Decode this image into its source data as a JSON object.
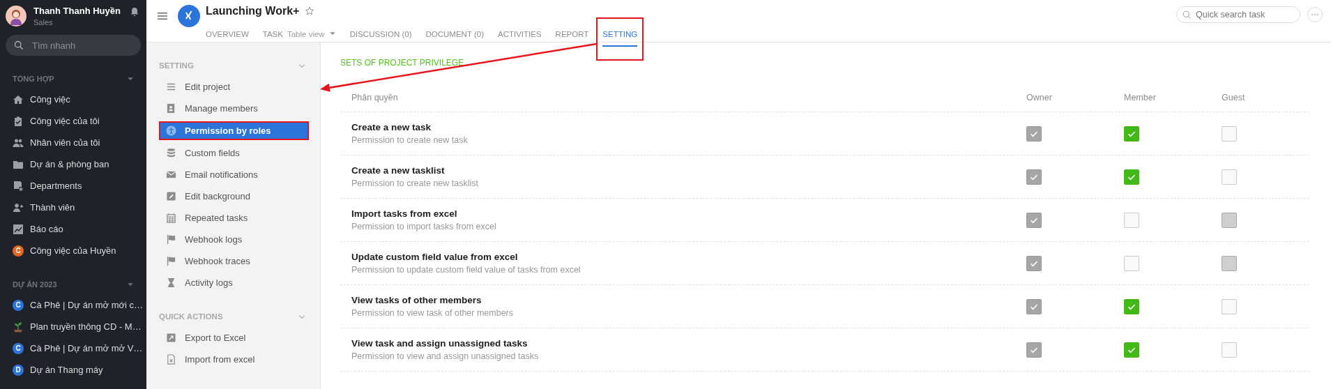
{
  "sidebar": {
    "user": {
      "name": "Thanh Thanh Huyền",
      "role": "Sales"
    },
    "search": {
      "placeholder": "Tìm nhanh"
    },
    "sections": [
      {
        "title": "TỔNG HỢP",
        "items": [
          {
            "label": "Công việc"
          },
          {
            "label": "Công việc của tôi"
          },
          {
            "label": "Nhân viên của tôi"
          },
          {
            "label": "Dự án & phòng ban"
          },
          {
            "label": "Departments"
          },
          {
            "label": "Thành viên"
          },
          {
            "label": "Báo cáo"
          },
          {
            "label": "Công việc của Huyền",
            "badge": "C",
            "color": "#e8671f"
          }
        ]
      },
      {
        "title": "DỰ ÁN 2023",
        "items": [
          {
            "label": "Cà Phê | Dự án mở mới c…",
            "badge": "C",
            "color": "#2d74da"
          },
          {
            "label": "Plan truyền thông CD - M…"
          },
          {
            "label": "Cà Phê | Dự án mở mở V…",
            "badge": "C",
            "color": "#2d74da"
          },
          {
            "label": "Dự án Thang máy",
            "badge": "D",
            "color": "#2d74da"
          }
        ]
      }
    ]
  },
  "header": {
    "title": "Launching Work+",
    "tabs": [
      {
        "label": "OVERVIEW",
        "selected": false,
        "highlighted": false
      },
      {
        "label": "TASK",
        "view": "Table view",
        "selected": false,
        "highlighted": false
      },
      {
        "label": "DISCUSSION (0)",
        "selected": false,
        "highlighted": false
      },
      {
        "label": "DOCUMENT (0)",
        "selected": false,
        "highlighted": false
      },
      {
        "label": "ACTIVITIES",
        "selected": false,
        "highlighted": false
      },
      {
        "label": "REPORT",
        "selected": false,
        "highlighted": false
      },
      {
        "label": "SETTING",
        "selected": true,
        "highlighted": true
      }
    ],
    "search": {
      "placeholder": "Quick search task"
    }
  },
  "settings_menu": {
    "sections": [
      {
        "title": "SETTING",
        "items": [
          {
            "label": "Edit project",
            "selected": false,
            "highlighted": false
          },
          {
            "label": "Manage members",
            "selected": false,
            "highlighted": false
          },
          {
            "label": "Permission by roles",
            "selected": true,
            "highlighted": true
          },
          {
            "label": "Custom fields",
            "selected": false,
            "highlighted": false
          },
          {
            "label": "Email notifications",
            "selected": false,
            "highlighted": false
          },
          {
            "label": "Edit background",
            "selected": false,
            "highlighted": false
          },
          {
            "label": "Repeated tasks",
            "selected": false,
            "highlighted": false
          },
          {
            "label": "Webhook logs",
            "selected": false,
            "highlighted": false
          },
          {
            "label": "Webhook traces",
            "selected": false,
            "highlighted": false
          },
          {
            "label": "Activity logs",
            "selected": false,
            "highlighted": false
          }
        ]
      },
      {
        "title": "QUICK ACTIONS",
        "items": [
          {
            "label": "Export to Excel",
            "selected": false,
            "highlighted": false
          },
          {
            "label": "Import from excel",
            "selected": false,
            "highlighted": false
          }
        ]
      }
    ]
  },
  "privileges": {
    "title": "SETS OF PROJECT PRIVILEGE",
    "columns": [
      "Phân quyền",
      "Owner",
      "Member",
      "Guest"
    ],
    "rows": [
      {
        "title": "Create a new task",
        "description": "Permission to create new task",
        "owner": {
          "checked": true,
          "disabled": true
        },
        "member": {
          "checked": true,
          "disabled": false
        },
        "guest": {
          "checked": false,
          "disabled": false
        }
      },
      {
        "title": "Create a new tasklist",
        "description": "Permission to create new tasklist",
        "owner": {
          "checked": true,
          "disabled": true
        },
        "member": {
          "checked": true,
          "disabled": false
        },
        "guest": {
          "checked": false,
          "disabled": false
        }
      },
      {
        "title": "Import tasks from excel",
        "description": "Permission to import tasks from excel",
        "owner": {
          "checked": true,
          "disabled": true
        },
        "member": {
          "checked": false,
          "disabled": false
        },
        "guest": {
          "checked": false,
          "disabled": true
        }
      },
      {
        "title": "Update custom field value from excel",
        "description": "Permission to update custom field value of tasks from excel",
        "owner": {
          "checked": true,
          "disabled": true
        },
        "member": {
          "checked": false,
          "disabled": false
        },
        "guest": {
          "checked": false,
          "disabled": true
        }
      },
      {
        "title": "View tasks of other members",
        "description": "Permission to view task of other members",
        "owner": {
          "checked": true,
          "disabled": true
        },
        "member": {
          "checked": true,
          "disabled": false
        },
        "guest": {
          "checked": false,
          "disabled": false
        }
      },
      {
        "title": "View task and assign unassigned tasks",
        "description": "Permission to view and assign unassigned tasks",
        "owner": {
          "checked": true,
          "disabled": true
        },
        "member": {
          "checked": true,
          "disabled": false
        },
        "guest": {
          "checked": false,
          "disabled": false
        }
      }
    ]
  },
  "annotation": {
    "arrow": true
  }
}
